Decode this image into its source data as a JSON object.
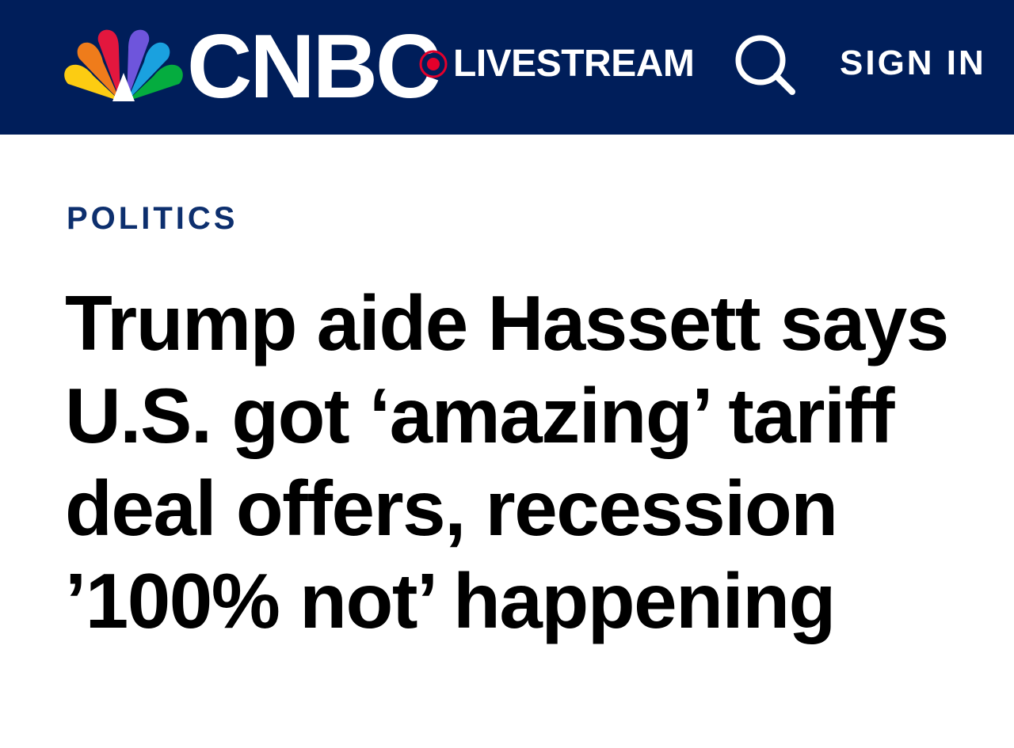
{
  "header": {
    "brand": "CNBC",
    "livestream_label": "LIVESTREAM",
    "signin_label": "SIGN IN",
    "background_color": "#001e5a",
    "live_indicator_color": "#e4002b"
  },
  "article": {
    "section": "POLITICS",
    "section_color": "#0d2f6e",
    "headline": "Trump aide Hassett says U.S. got ‘amazing’ tariff deal offers, recession ’100% not’ happening"
  },
  "icons": {
    "logo": "nbc-peacock-icon",
    "live": "live-dot-icon",
    "search": "search-icon"
  }
}
